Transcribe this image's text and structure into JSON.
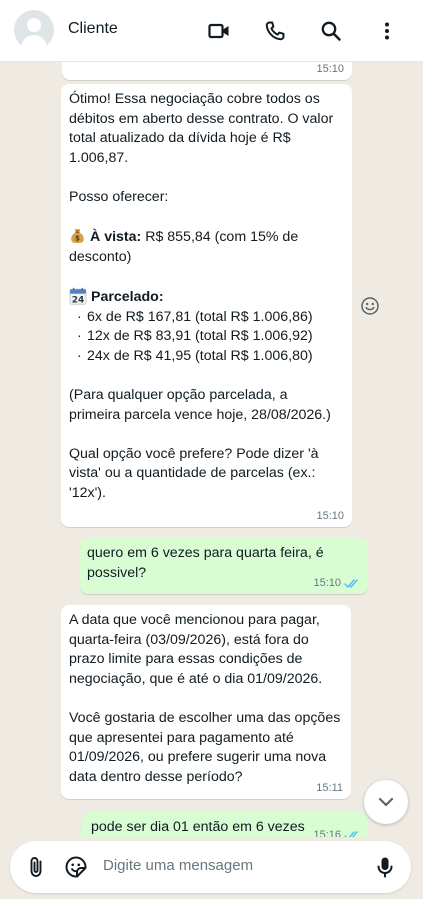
{
  "header": {
    "contact_name": "Cliente"
  },
  "messages": {
    "m0": {
      "time": "15:10"
    },
    "m1": {
      "p1": "Ótimo! Essa negociação cobre todos os débitos em aberto desse contrato. O valor total atualizado da dívida hoje é R$ 1.006,87.",
      "p2": "Posso oferecer:",
      "vista_label": "À vista:",
      "vista_text": "R$ 855,84 (com 15% de desconto)",
      "parcelado_label": "Parcelado:",
      "calendar_day": "24",
      "bullet": "·",
      "options": [
        "6x de R$ 167,81 (total R$ 1.006,86)",
        "12x de R$ 83,91 (total R$ 1.006,92)",
        "24x de R$ 41,95 (total R$ 1.006,80)"
      ],
      "p3": "(Para qualquer opção parcelada, a primeira parcela vence hoje, 28/08/2026.)",
      "p4": "Qual opção você prefere? Pode dizer 'à vista' ou a quantidade de parcelas (ex.: '12x').",
      "time": "15:10"
    },
    "m2": {
      "text": "quero em 6 vezes para quarta feira, é possivel?",
      "time": "15:10"
    },
    "m3": {
      "p1": "A data que você mencionou para pagar, quarta-feira (03/09/2026), está fora do prazo limite para essas condições de negociação, que é até o dia 01/09/2026.",
      "p2": "Você gostaria de escolher uma das opções que apresentei para pagamento até 01/09/2026, ou prefere sugerir uma nova data dentro desse período?",
      "time": "15:11"
    },
    "m4": {
      "text": "pode ser dia 01 então em 6 vezes",
      "time": "15:16"
    }
  },
  "composer": {
    "placeholder": "Digite uma mensagem"
  },
  "colors": {
    "chat_bg": "#efeae2",
    "incoming_bubble": "#ffffff",
    "outgoing_bubble": "#d9fdd3",
    "read_ticks": "#53bdeb",
    "icon": "#111b21"
  },
  "icons": {
    "video": "video-call-icon",
    "phone": "voice-call-icon",
    "search": "search-icon",
    "menu": "more-options-icon",
    "react": "emoji-reaction-icon",
    "scroll": "chevron-down-icon",
    "attach": "paperclip-icon",
    "sticker": "sticker-icon",
    "mic": "microphone-icon"
  }
}
